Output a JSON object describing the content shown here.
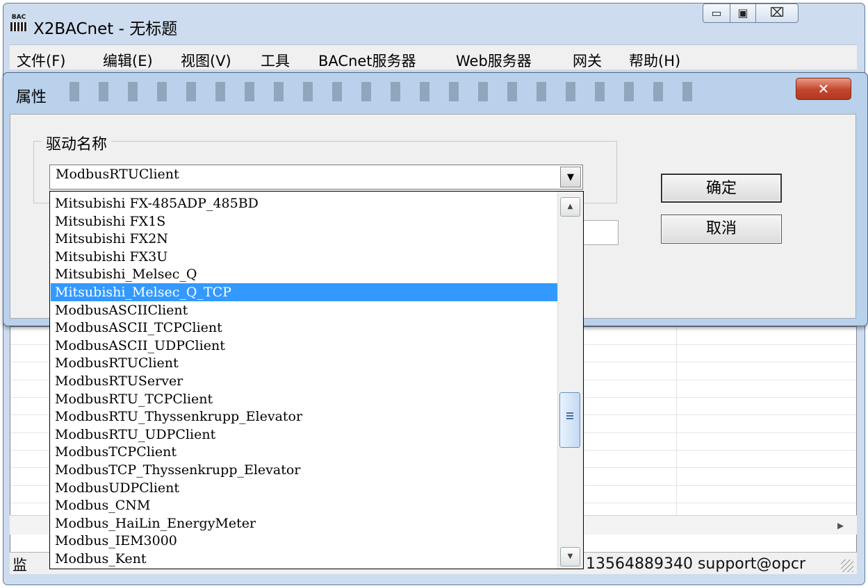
{
  "window": {
    "title": "X2BACnet - 无标题",
    "app_icon_text": "BAC",
    "min_glyph": "▭",
    "max_glyph": "▣",
    "close_glyph": "⌧"
  },
  "menu": [
    {
      "label": "文件(F)"
    },
    {
      "label": "编辑(E)"
    },
    {
      "label": "视图(V)"
    },
    {
      "label": "工具"
    },
    {
      "label": "BACnet服务器"
    },
    {
      "label": "Web服务器"
    },
    {
      "label": "网关"
    },
    {
      "label": "帮助(H)"
    }
  ],
  "dialog": {
    "title": "属性",
    "close_glyph": "✕",
    "group_label": "驱动名称",
    "combo_value": "ModbusRTUClient",
    "ok_label": "确定",
    "cancel_label": "取消"
  },
  "dropdown": {
    "selected_index": 5,
    "options": [
      "Mitsubishi FX-485ADP_485BD",
      "Mitsubishi FX1S",
      "Mitsubishi FX2N",
      "Mitsubishi FX3U",
      "Mitsubishi_Melsec_Q",
      "Mitsubishi_Melsec_Q_TCP",
      "ModbusASCIIClient",
      "ModbusASCII_TCPClient",
      "ModbusASCII_UDPClient",
      "ModbusRTUClient",
      "ModbusRTUServer",
      "ModbusRTU_TCPClient",
      "ModbusRTU_Thyssenkrupp_Elevator",
      "ModbusRTU_UDPClient",
      "ModbusTCPClient",
      "ModbusTCP_Thyssenkrupp_Elevator",
      "ModbusUDPClient",
      "Modbus_CNM",
      "Modbus_HaiLin_EnergyMeter",
      "Modbus_IEM3000",
      "Modbus_Kent"
    ]
  },
  "statusbar": {
    "left_text": "监",
    "contact": "13564889340 support@opcr"
  },
  "colors": {
    "selection": "#3399ff",
    "dialog_frame": "#b9d1ea",
    "close_red": "#c4452c"
  }
}
